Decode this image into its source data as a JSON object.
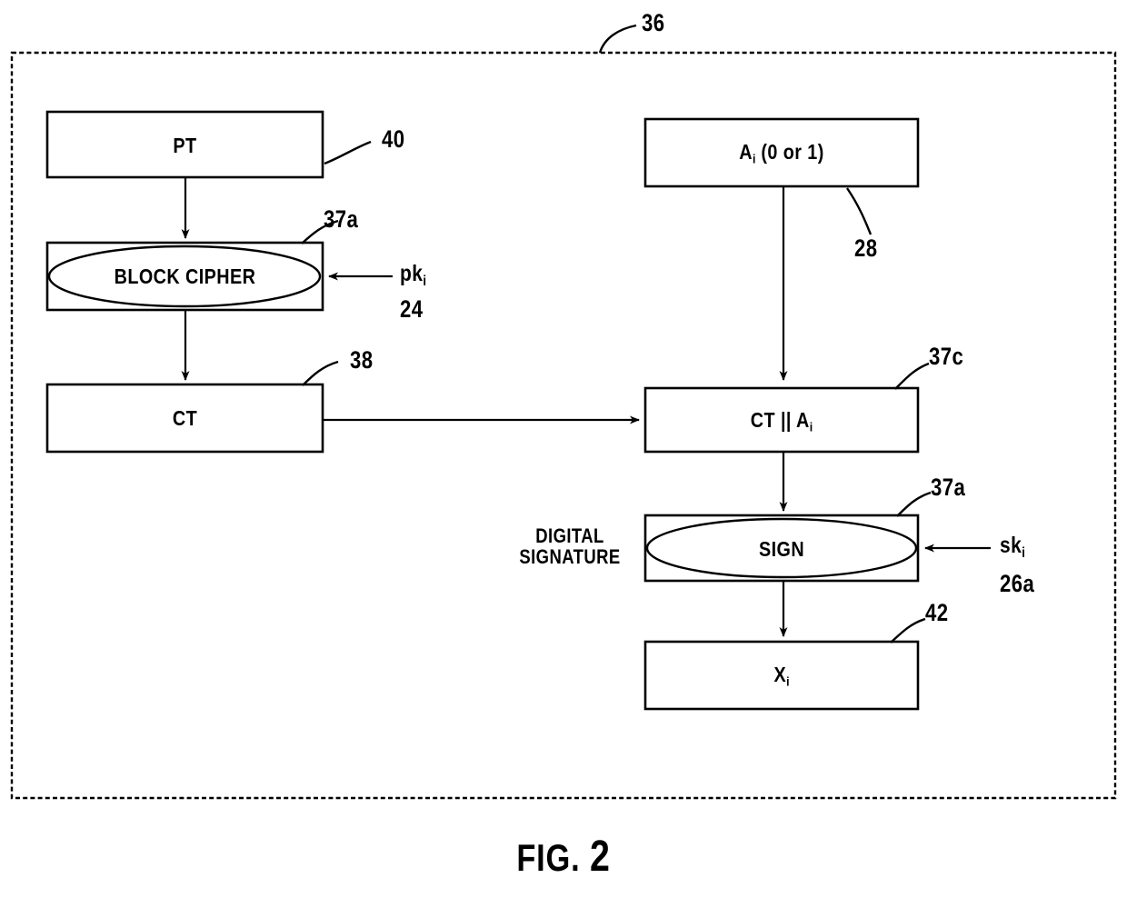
{
  "figure": {
    "caption_prefix": "FIG.",
    "caption_number": "2",
    "outer_frame_ref": "36"
  },
  "blocks": [
    {
      "id": "pt",
      "label": "PT",
      "ref": "40",
      "shape": "rect"
    },
    {
      "id": "block-cipher",
      "label": "BLOCK CIPHER",
      "ref": "37a",
      "shape": "rect-ellipse"
    },
    {
      "id": "ct",
      "label": "CT",
      "ref": "38",
      "shape": "rect"
    },
    {
      "id": "ai",
      "label_main": "A",
      "label_sub": "i",
      "label_tail": " (0 or 1)",
      "ref": "28",
      "shape": "rect"
    },
    {
      "id": "ct-concat-ai",
      "label_main": "CT  ||  A",
      "label_sub": "i",
      "label_tail": "",
      "ref": "37c",
      "shape": "rect"
    },
    {
      "id": "sign",
      "label": "SIGN",
      "ref": "37a",
      "shape": "rect-ellipse"
    },
    {
      "id": "xi",
      "label_main": "X",
      "label_sub": "i",
      "label_tail": "",
      "ref": "42",
      "shape": "rect"
    }
  ],
  "keys": [
    {
      "id": "pk",
      "main": "pk",
      "sub": "i",
      "ref": "24"
    },
    {
      "id": "sk",
      "main": "sk",
      "sub": "i",
      "ref": "26a"
    }
  ],
  "annotations": {
    "digital_signature_line1": "DIGITAL",
    "digital_signature_line2": "SIGNATURE"
  },
  "colors": {
    "ink": "#000000",
    "paper": "#ffffff"
  }
}
